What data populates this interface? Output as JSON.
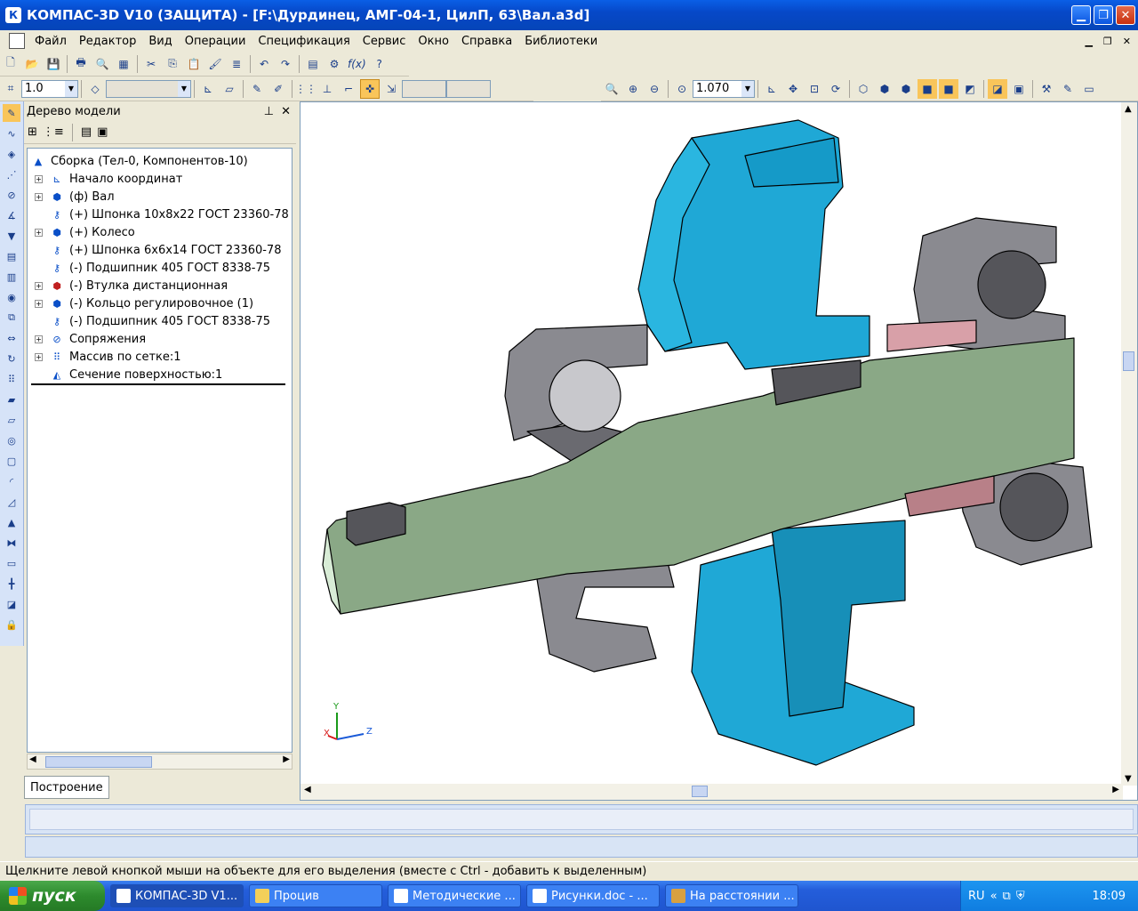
{
  "window": {
    "title": "КОМПАС-3D V10 (ЗАЩИТА) - [F:\\Дурдинец, АМГ-04-1, ЦилП, 63\\Вал.a3d]",
    "app_icon": "К"
  },
  "menu": [
    "Файл",
    "Редактор",
    "Вид",
    "Операции",
    "Спецификация",
    "Сервис",
    "Окно",
    "Справка",
    "Библиотеки"
  ],
  "toolbar": {
    "step_value": "1.0",
    "zoom_value": "1.070",
    "fx_label": "f(x)"
  },
  "tree_panel": {
    "title": "Дерево модели",
    "nodes": [
      {
        "label": "Сборка (Тел-0, Компонентов-10)",
        "icon": "assembly-icon"
      },
      {
        "label": "Начало координат",
        "icon": "origin-icon"
      },
      {
        "label": "(ф) Вал",
        "icon": "part-icon"
      },
      {
        "label": "(+) Шпонка 10x8x22 ГОСТ 23360-78",
        "icon": "key-part-icon"
      },
      {
        "label": "(+) Колесо",
        "icon": "part-icon"
      },
      {
        "label": "(+) Шпонка 6x6x14 ГОСТ 23360-78",
        "icon": "key-part-icon"
      },
      {
        "label": "(-) Подшипник 405 ГОСТ 8338-75",
        "icon": "key-part-icon"
      },
      {
        "label": "(-) Втулка дистанционная",
        "icon": "part-icon"
      },
      {
        "label": "(-) Кольцо регулировочное (1)",
        "icon": "part-icon"
      },
      {
        "label": "(-) Подшипник 405 ГОСТ 8338-75",
        "icon": "key-part-icon"
      },
      {
        "label": "Сопряжения",
        "icon": "mates-icon"
      },
      {
        "label": "Массив по сетке:1",
        "icon": "grid-array-icon"
      },
      {
        "label": "Сечение поверхностью:1",
        "icon": "section-icon"
      }
    ],
    "tab_label": "Построение"
  },
  "viewport": {
    "axis_labels": {
      "x": "X",
      "y": "Y",
      "z": "Z"
    }
  },
  "status": {
    "text": "Щелкните левой кнопкой мыши на объекте для его выделения (вместе с Ctrl - добавить к выделенным)"
  },
  "taskbar": {
    "start_label": "пуск",
    "tasks": [
      "КОМПАС-3D V1...",
      "Процив",
      "Методические ...",
      "Рисунки.doc - ...",
      "На расстоянии ..."
    ],
    "lang": "RU",
    "clock": "18:09"
  },
  "colors": {
    "title_blue": "#0648c8",
    "wheel_cyan": "#1fa8d6",
    "shaft_green": "#8aa886",
    "bearing_gray": "#6a6a6e"
  }
}
